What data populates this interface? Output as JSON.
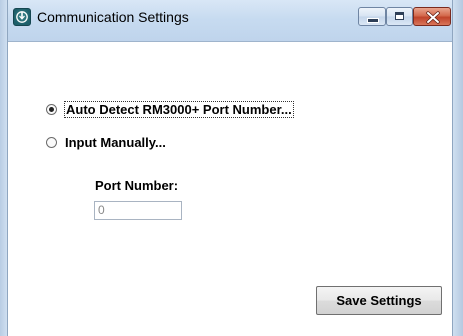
{
  "window": {
    "title": "Communication Settings",
    "icon": "app-logo-icon",
    "controls": [
      "minimize-icon",
      "maximize-icon",
      "close-icon"
    ]
  },
  "options": [
    {
      "label": "Auto Detect RM3000+ Port Number...",
      "selected": true
    },
    {
      "label": "Input Manually...",
      "selected": false
    }
  ],
  "port": {
    "label": "Port Number:",
    "value": "0"
  },
  "actions": {
    "save_label": "Save Settings"
  },
  "colors": {
    "titlebar": "#c7dbf0",
    "close_button": "#c0432a"
  }
}
